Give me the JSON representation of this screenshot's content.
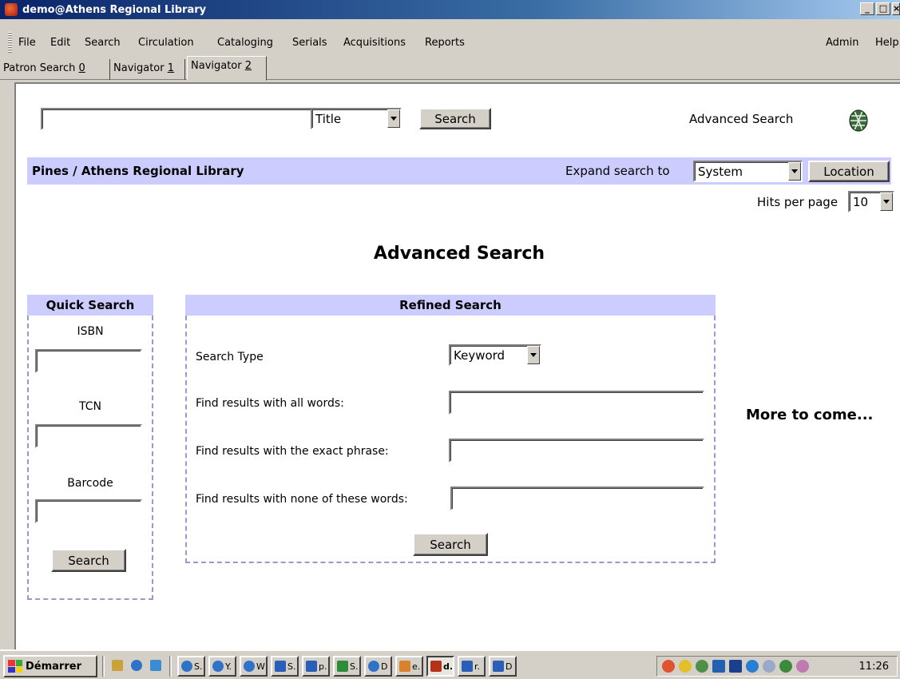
{
  "window": {
    "title": "demo@Athens Regional Library"
  },
  "menu": {
    "left": [
      "File",
      "Edit",
      "Search",
      "Circulation",
      "Cataloging",
      "Serials",
      "Acquisitions",
      "Reports"
    ],
    "right": [
      "Admin",
      "Help"
    ]
  },
  "tabs": [
    {
      "label": "Patron Search",
      "num": "0",
      "active": false
    },
    {
      "label": "Navigator",
      "num": "1",
      "active": false
    },
    {
      "label": "Navigator",
      "num": "2",
      "active": true
    }
  ],
  "topsearch": {
    "input_value": "",
    "type_selected": "Title",
    "button_label": "Search",
    "advanced_link": "Advanced Search"
  },
  "libbar": {
    "name": "Pines / Athens Regional Library",
    "expand_label": "Expand search to",
    "scope_selected": "System",
    "location_button": "Location"
  },
  "hits": {
    "label": "Hits per page",
    "selected": "10"
  },
  "page_title": "Advanced Search",
  "quick": {
    "title": "Quick Search",
    "isbn_label": "ISBN",
    "tcn_label": "TCN",
    "barcode_label": "Barcode",
    "button_label": "Search"
  },
  "refined": {
    "title": "Refined Search",
    "search_type_label": "Search Type",
    "search_type_selected": "Keyword",
    "all_words_label": "Find results with all words:",
    "exact_phrase_label": "Find results with the exact phrase:",
    "none_words_label": "Find results with none of these words:",
    "button_label": "Search"
  },
  "more": "More to come...",
  "taskbar": {
    "start_label": "Démarrer",
    "tasks": [
      "S.",
      "Y.",
      "W",
      "S.",
      "p.",
      "S.",
      "D",
      "e.",
      "d.",
      "r.",
      "D"
    ],
    "clock": "11:26"
  },
  "colors": {
    "title_gradient_start": "#0a246a",
    "header_band": "#ccccff",
    "dashed_border": "#9999cc"
  }
}
